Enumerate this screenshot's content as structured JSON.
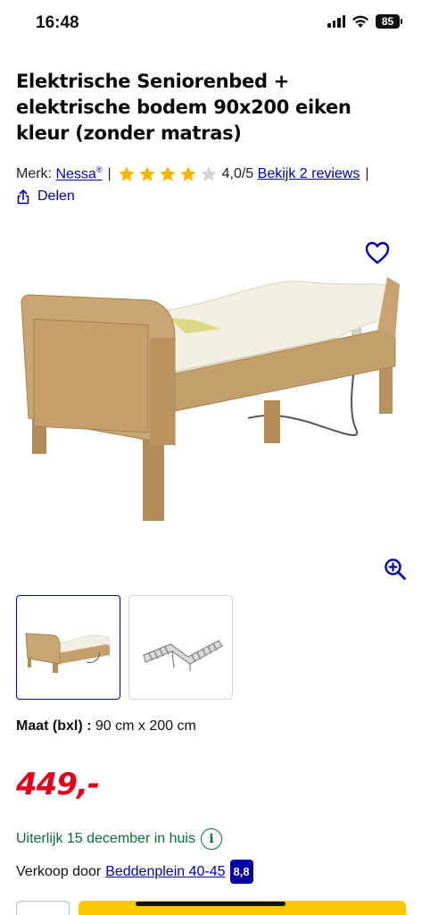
{
  "status_bar": {
    "time": "16:48",
    "battery": "85",
    "icons": [
      "signal-icon",
      "wifi-icon",
      "battery-icon"
    ]
  },
  "product": {
    "title": "Elektrische Seniorenbed + elektrische bodem 90x200 eiken kleur (zonder matras)",
    "brand_label": "Merk:",
    "brand": "Nessa",
    "brand_mark": "®",
    "separator": "|",
    "rating": 4,
    "rating_max": 5,
    "rating_text": "4,0/5",
    "reviews_link": "Bekijk 2 reviews",
    "share_label": "Delen"
  },
  "gallery": {
    "thumbnails": [
      "bed-thumbnail",
      "slatted-base-thumbnail"
    ],
    "active_index": 0
  },
  "specs": {
    "maat_label": "Maat (bxl) :",
    "maat_value": "90 cm x 200 cm"
  },
  "pricing": {
    "price": "449,-"
  },
  "delivery": {
    "text": "Uiterlijk 15 december in huis",
    "info_icon": "i"
  },
  "seller": {
    "label": "Verkoop door",
    "name": "Beddenplein 40-45",
    "score": "8,8"
  },
  "colors": {
    "link_blue": "#0000a4",
    "price_red": "#e0001b",
    "delivery_green": "#0b6c3a",
    "star_yellow": "#f7b500",
    "cart_yellow": "#fcc800"
  }
}
